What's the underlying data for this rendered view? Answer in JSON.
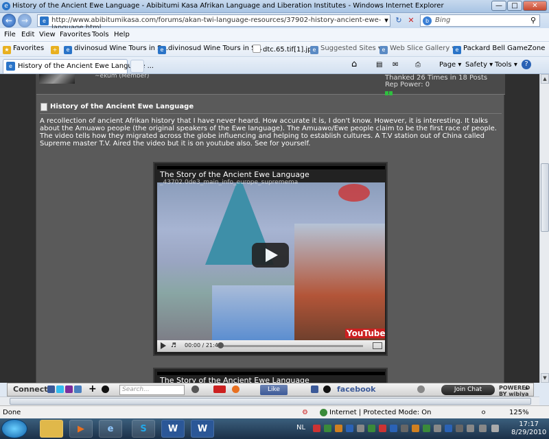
{
  "window": {
    "title": "History of the Ancient Ewe Language - Abibitumi Kasa Afrikan Language and Liberation Institutes - Windows Internet Explorer"
  },
  "address_bar": {
    "url": "http://www.abibitumikasa.com/forums/akan-twi-language-resources/37902-history-ancient-ewe-language.html",
    "search_placeholder": "Bing"
  },
  "menu": [
    "File",
    "Edit",
    "View",
    "Favorites",
    "Tools",
    "Help"
  ],
  "favorites_bar": {
    "favorites_label": "Favorites",
    "items": [
      "divinosud Wine Tours in S...",
      "divinosud Wine Tours in S...",
      "dtc.65.tif[1].jpg",
      "Suggested Sites ▾",
      "Web Slice Gallery ▾",
      "Packard Bell GameZone"
    ]
  },
  "tab": {
    "title": "History of the Ancient Ewe Language ..."
  },
  "command_bar": {
    "page": "Page ▾",
    "safety": "Safety ▾",
    "tools": "Tools ▾"
  },
  "post_header": {
    "member": "~ekum (Member)",
    "thanked": "Thanked 26 Times in 18 Posts",
    "rep_power": "Rep Power: 0"
  },
  "post": {
    "title": "History of the Ancient Ewe Language",
    "body": "A recollection of ancient Afrikan history that I have never heard. How accurate it is, I don't know. However, it is interesting. It talks about the Amuawo people (the original speakers of the Ewe language). The Amuawo/Ewe people claim to be the first race of people. The video tells how they migrated across the globe influencing and helping to establish cultures. A T.V station out of China called Supreme master T.V. Aired the video but it is on youtube also. See for yourself."
  },
  "videos": [
    {
      "title": "The Story of the Ancient Ewe Language",
      "url_overlay": "_43702.0de3_main_info_europe_supremema",
      "time": "00:00 / 21:48",
      "logo": "YouTube",
      "progress": 0.0
    },
    {
      "title": "The Story of the Ancient Ewe Language"
    }
  ],
  "wibiya_bar": {
    "connect": "Connect",
    "search_placeholder": "Search...",
    "like": "Like",
    "facebook": "facebook",
    "join_chat": "Join Chat",
    "powered": "POWERED BY wibiya"
  },
  "status_bar": {
    "status": "Done",
    "zone": "Internet | Protected Mode: On",
    "zoom": "125%"
  },
  "taskbar": {
    "language": "NL",
    "time": "17:17",
    "date": "8/29/2010"
  },
  "colors": {
    "content_bg": "#5a5a5a",
    "link_green": "#2fbf3f",
    "facebook_blue": "#3b5998"
  }
}
